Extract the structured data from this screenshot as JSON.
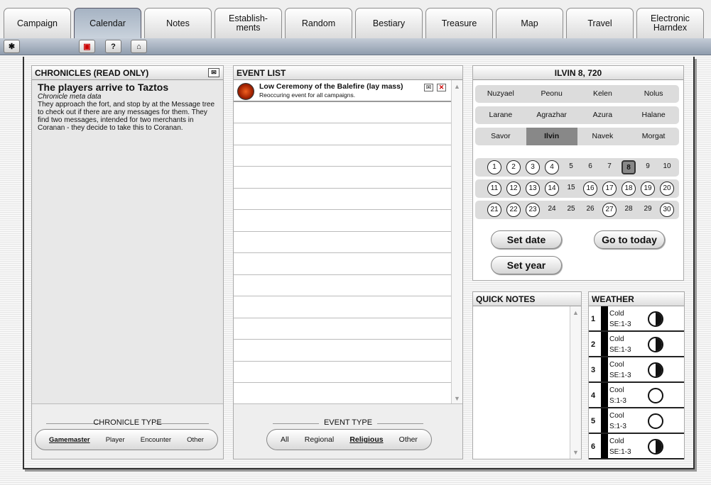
{
  "tabs": [
    "Campaign",
    "Calendar",
    "Notes",
    "Establish-\nments",
    "Random",
    "Bestiary",
    "Treasure",
    "Map",
    "Travel",
    "Electronic\nHarndex"
  ],
  "active_tab": "Calendar",
  "toolbar": {
    "help_label": "?"
  },
  "chronicles": {
    "header": "CHRONICLES (READ ONLY)",
    "title": "The players arrive to Taztos",
    "meta": "Chronicle meta data",
    "text": "They approach the fort, and stop by at the Message tree to check out if there are any messages for them. They find two messages, intended for two merchants in Coranan - they decide to take this to Coranan.",
    "type_label": "CHRONICLE TYPE",
    "types": [
      "Gamemaster",
      "Player",
      "Encounter",
      "Other"
    ],
    "selected_type": "Gamemaster"
  },
  "events": {
    "header": "EVENT LIST",
    "items": [
      {
        "title": "Low Ceremony of the Balefire (lay mass)",
        "subtitle": "Reoccuring event for all campaigns."
      }
    ],
    "type_label": "EVENT TYPE",
    "types": [
      "All",
      "Regional",
      "Religious",
      "Other"
    ],
    "selected_type": "Religious"
  },
  "calendar": {
    "header": "ILVIN 8, 720",
    "months": [
      [
        "Nuzyael",
        "Peonu",
        "Kelen",
        "Nolus"
      ],
      [
        "Larane",
        "Agrazhar",
        "Azura",
        "Halane"
      ],
      [
        "Savor",
        "Ilvin",
        "Navek",
        "Morgat"
      ]
    ],
    "selected_month": "Ilvin",
    "days": [
      [
        {
          "n": "1",
          "c": true
        },
        {
          "n": "2",
          "c": true
        },
        {
          "n": "3",
          "c": true
        },
        {
          "n": "4",
          "c": true
        },
        {
          "n": "5",
          "c": false
        },
        {
          "n": "6",
          "c": false
        },
        {
          "n": "7",
          "c": false
        },
        {
          "n": "8",
          "c": true,
          "today": true
        },
        {
          "n": "9",
          "c": false
        },
        {
          "n": "10",
          "c": false
        }
      ],
      [
        {
          "n": "11",
          "c": true
        },
        {
          "n": "12",
          "c": true
        },
        {
          "n": "13",
          "c": true
        },
        {
          "n": "14",
          "c": true
        },
        {
          "n": "15",
          "c": false
        },
        {
          "n": "16",
          "c": true
        },
        {
          "n": "17",
          "c": true
        },
        {
          "n": "18",
          "c": true
        },
        {
          "n": "19",
          "c": true
        },
        {
          "n": "20",
          "c": true
        }
      ],
      [
        {
          "n": "21",
          "c": true
        },
        {
          "n": "22",
          "c": true
        },
        {
          "n": "23",
          "c": true
        },
        {
          "n": "24",
          "c": false
        },
        {
          "n": "25",
          "c": false
        },
        {
          "n": "26",
          "c": false
        },
        {
          "n": "27",
          "c": true
        },
        {
          "n": "28",
          "c": false
        },
        {
          "n": "29",
          "c": false
        },
        {
          "n": "30",
          "c": true
        }
      ]
    ],
    "set_date": "Set date",
    "go_today": "Go to today",
    "set_year": "Set year"
  },
  "quick_notes": {
    "header": "QUICK NOTES"
  },
  "weather": {
    "header": "WEATHER",
    "rows": [
      {
        "n": "1",
        "temp": "Cold",
        "wind": "SE:1-3",
        "moon": "first-quarter"
      },
      {
        "n": "2",
        "temp": "Cold",
        "wind": "SE:1-3",
        "moon": "first-quarter"
      },
      {
        "n": "3",
        "temp": "Cool",
        "wind": "SE:1-3",
        "moon": "first-quarter"
      },
      {
        "n": "4",
        "temp": "Cool",
        "wind": "S:1-3",
        "moon": "full"
      },
      {
        "n": "5",
        "temp": "Cool",
        "wind": "S:1-3",
        "moon": "full"
      },
      {
        "n": "6",
        "temp": "Cold",
        "wind": "SE:1-3",
        "moon": "first-quarter"
      }
    ]
  }
}
